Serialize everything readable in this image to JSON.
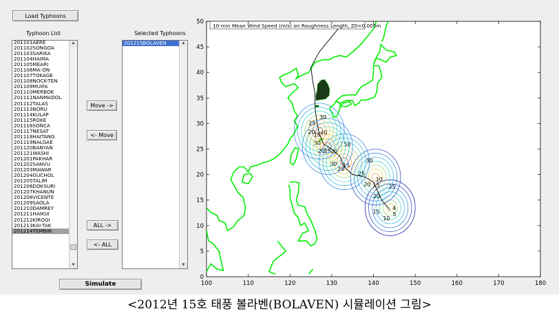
{
  "buttons": {
    "load_typhoons": "Load Typhoons",
    "move_right": "Move ->",
    "move_left": "<- Move",
    "all_right": "ALL ->",
    "all_left": "<- ALL",
    "simulate": "Simulate"
  },
  "labels": {
    "typhoon_list": "Typhoon List",
    "selected_typhoons": "Selected Typhoons"
  },
  "typhoon_list": {
    "items": [
      "201101AERE",
      "201102SONGDA",
      "201103SARIKA",
      "201104HAIMA",
      "201105MEARI",
      "201106MA-ON",
      "201107TOKAGE",
      "201108NOCK-TEN",
      "201109MUIFA",
      "201110MERBOK",
      "201111NANMADOL",
      "201112TALAS",
      "201113NORU",
      "201114KULAP",
      "201115ROKE",
      "201116SONCA",
      "201117NESAT",
      "201118HAITANG",
      "201119NALGAE",
      "201120BANYAN",
      "201121WASHI",
      "201201PAKHAR",
      "201202SANVU",
      "201203MAWAR",
      "201204GUCHOL",
      "201205TALIM",
      "201206DOKSURI",
      "201207KHANUN",
      "201208VICENTE",
      "201209SAOLA",
      "201210DAMREY",
      "201211HAIKUI",
      "201212KIROGI",
      "201213KAI-TAK",
      "201214TEMBIN"
    ],
    "selected_item": "201214TEMBIN"
  },
  "selected_typhoons": {
    "items": [
      "201215BOLAVEN"
    ]
  },
  "plot": {
    "title": "10-min Mean Wind Speed (m/s) on Roughness Length, Z0=0.005m",
    "xlim": [
      100,
      180
    ],
    "ylim": [
      0,
      50
    ],
    "xticks": [
      100,
      110,
      120,
      130,
      140,
      150,
      160,
      170,
      180
    ],
    "yticks": [
      0,
      5,
      10,
      15,
      20,
      25,
      30,
      35,
      40,
      45,
      50
    ],
    "colors": {
      "coastline": "#00ee00",
      "track": "#000000"
    }
  },
  "chart_data": {
    "type": "scatter",
    "title": "10-min Mean Wind Speed (m/s) on Roughness Length, Z0=0.005m",
    "xlabel": "",
    "ylabel": "",
    "xlim": [
      100,
      180
    ],
    "ylim": [
      0,
      50
    ],
    "grid": false,
    "track": [
      [
        144,
        13
      ],
      [
        142,
        15
      ],
      [
        140,
        18.5
      ],
      [
        138,
        19.5
      ],
      [
        135,
        20
      ],
      [
        133,
        21.5
      ],
      [
        132,
        23.5
      ],
      [
        130,
        25
      ],
      [
        128,
        26
      ],
      [
        127,
        28
      ],
      [
        126.5,
        30
      ],
      [
        126,
        33
      ],
      [
        126,
        36
      ],
      [
        125.5,
        38
      ],
      [
        125,
        41
      ],
      [
        127,
        44
      ],
      [
        130,
        47
      ],
      [
        132,
        49
      ]
    ],
    "contour_centers": [
      {
        "x": 144,
        "y": 13.5,
        "levels": [
          "4",
          "5",
          "10",
          "15",
          "20",
          "25"
        ],
        "color": "#3030a0"
      },
      {
        "x": 140.5,
        "y": 19.5,
        "levels": [
          "10",
          "15",
          "20",
          "25",
          "30"
        ],
        "color": "#4060d0"
      },
      {
        "x": 133,
        "y": 22.5,
        "levels": [
          "15",
          "20",
          "30",
          "40",
          "50"
        ],
        "color": "#40a0e0"
      },
      {
        "x": 129,
        "y": 25.5,
        "levels": [
          "15",
          "20",
          "30",
          "40"
        ],
        "color": "#30c0e0"
      },
      {
        "x": 127,
        "y": 28.5,
        "levels": [
          "15",
          "20",
          "25",
          "30"
        ],
        "color": "#60c8f0"
      }
    ],
    "annotations": [
      "4",
      "5",
      "10",
      "15",
      "20",
      "25",
      "30",
      "40",
      "50"
    ]
  },
  "caption": "<2012년 15호 태풍 볼라벤(BOLAVEN) 시뮬레이션 그림>"
}
